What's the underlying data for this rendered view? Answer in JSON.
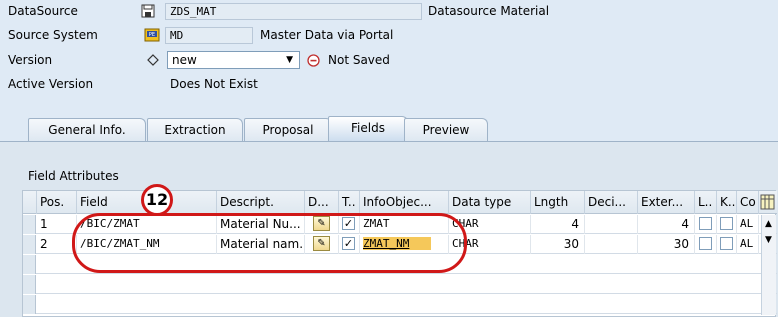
{
  "header": {
    "datasource_label": "DataSource",
    "datasource_value": "ZDS_MAT",
    "datasource_desc": "Datasource Material",
    "source_system_label": "Source System",
    "source_system_value": "MD",
    "source_system_desc": "Master Data via Portal",
    "version_label": "Version",
    "version_value": "new",
    "version_status": "Not Saved",
    "active_version_label": "Active Version",
    "active_version_value": "Does Not Exist"
  },
  "tabs": [
    {
      "label": "General Info."
    },
    {
      "label": "Extraction"
    },
    {
      "label": "Proposal"
    },
    {
      "label": "Fields"
    },
    {
      "label": "Preview"
    }
  ],
  "group": {
    "title": "Field Attributes"
  },
  "callout": {
    "number": "12"
  },
  "grid": {
    "columns": [
      "Pos.",
      "Field",
      "Descript.",
      "D...",
      "T..",
      "InfoObjec...",
      "Data type",
      "Lngth",
      "Deci...",
      "Exter...",
      "L..",
      "K..",
      "Co"
    ],
    "rows": [
      {
        "pos": "1",
        "field": "/BIC/ZMAT",
        "desc": "Material Nu...",
        "transfer": "✓",
        "infoobject": "ZMAT",
        "datatype": "CHAR",
        "length": "4",
        "decimals": "",
        "external": "4",
        "key": "AL"
      },
      {
        "pos": "2",
        "field": "/BIC/ZMAT_NM",
        "desc": "Material nam...",
        "transfer": "✓",
        "infoobject": "ZMAT_NM",
        "datatype": "CHAR",
        "length": "30",
        "decimals": "",
        "external": "30",
        "key": "AL"
      }
    ]
  },
  "colors": {
    "callout": "#d01818",
    "background": "#dfeaf5",
    "highlight": "#f5c85a"
  }
}
